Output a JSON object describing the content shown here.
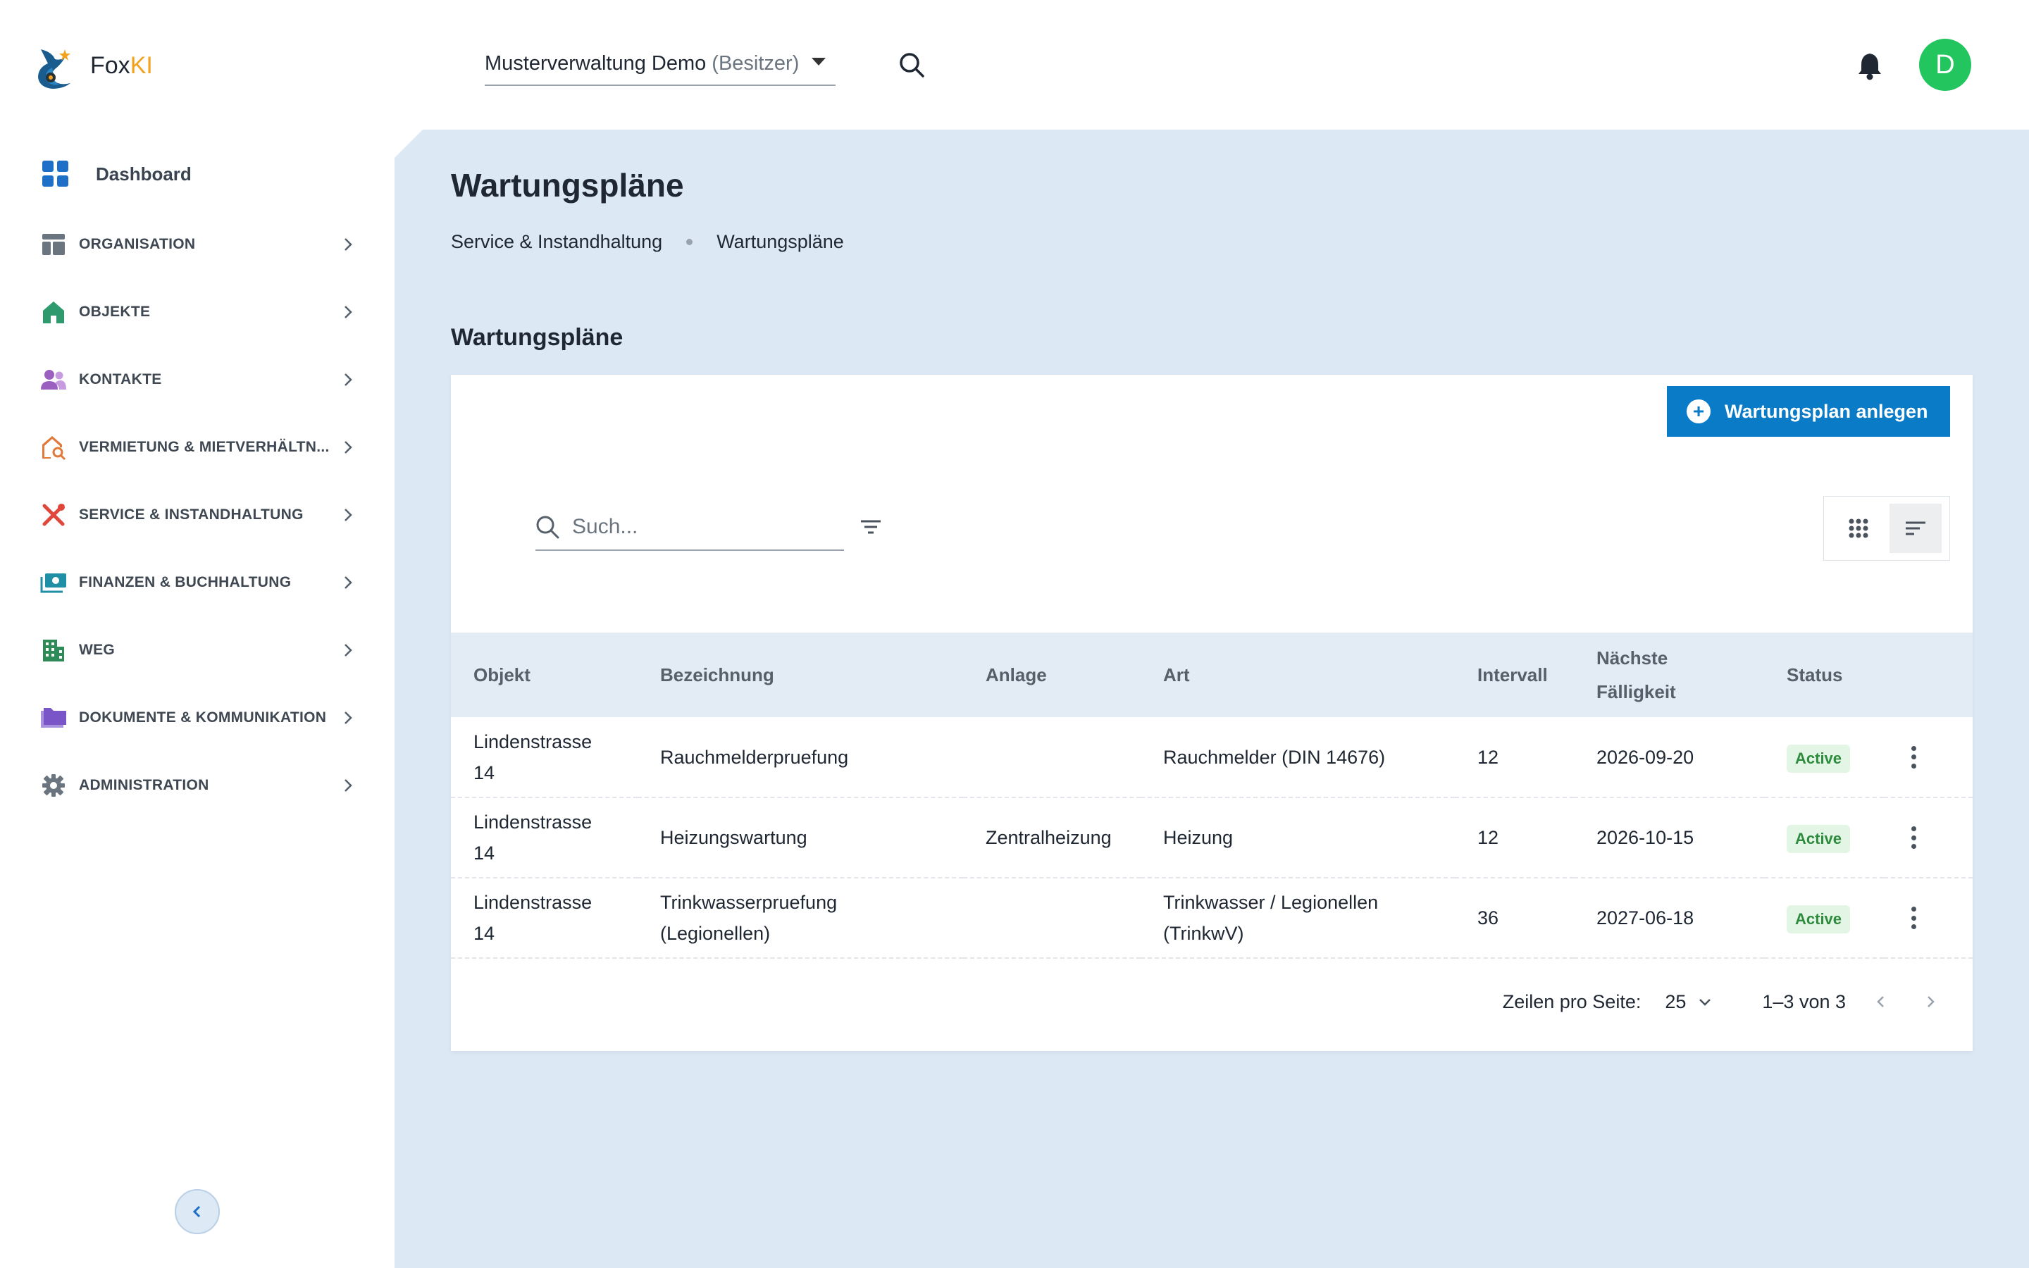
{
  "header": {
    "brand_prefix": "Fox",
    "brand_suffix": "KI",
    "org_name": "Musterverwaltung Demo",
    "org_role": "(Besitzer)",
    "avatar_initial": "D"
  },
  "sidebar": {
    "dashboard_label": "Dashboard",
    "items": [
      {
        "label": "ORGANISATION",
        "icon": "layout-icon",
        "color": "#6b7580"
      },
      {
        "label": "OBJEKTE",
        "icon": "home-icon",
        "color": "#2e9a6e"
      },
      {
        "label": "KONTAKTE",
        "icon": "people-icon",
        "color": "#9b5fc0"
      },
      {
        "label": "VERMIETUNG & MIETVERHÄLTN...",
        "icon": "house-search-icon",
        "color": "#e0793a"
      },
      {
        "label": "SERVICE & INSTANDHALTUNG",
        "icon": "tools-icon",
        "color": "#e0473a"
      },
      {
        "label": "FINANZEN & BUCHHALTUNG",
        "icon": "money-icon",
        "color": "#1f8fa6"
      },
      {
        "label": "WEG",
        "icon": "building-icon",
        "color": "#2e8b57"
      },
      {
        "label": "DOKUMENTE & KOMMUNIKATION",
        "icon": "folder-icon",
        "color": "#7a55c8"
      },
      {
        "label": "ADMINISTRATION",
        "icon": "gear-icon",
        "color": "#6b7580"
      }
    ]
  },
  "main": {
    "page_title": "Wartungspläne",
    "breadcrumb": [
      "Service & Instandhaltung",
      "Wartungspläne"
    ],
    "section_title": "Wartungspläne",
    "add_button_label": "Wartungsplan anlegen",
    "search_placeholder": "Such...",
    "columns": [
      "Objekt",
      "Bezeichnung",
      "Anlage",
      "Art",
      "Intervall",
      "Nächste Fälligkeit",
      "Status"
    ],
    "rows": [
      {
        "objekt": "Lindenstrasse 14",
        "bezeichnung": "Rauchmelderpruefung",
        "anlage": "",
        "art": "Rauchmelder (DIN 14676)",
        "intervall": "12",
        "faelligkeit": "2026-09-20",
        "status": "Active"
      },
      {
        "objekt": "Lindenstrasse 14",
        "bezeichnung": "Heizungswartung",
        "anlage": "Zentralheizung",
        "art": "Heizung",
        "intervall": "12",
        "faelligkeit": "2026-10-15",
        "status": "Active"
      },
      {
        "objekt": "Lindenstrasse 14",
        "bezeichnung": "Trinkwasserpruefung (Legionellen)",
        "anlage": "",
        "art": "Trinkwasser / Legionellen (TrinkwV)",
        "intervall": "36",
        "faelligkeit": "2027-06-18",
        "status": "Active"
      }
    ],
    "pagination": {
      "rows_per_page_label": "Zeilen pro Seite:",
      "rows_per_page": "25",
      "range": "1–3 von 3"
    }
  }
}
